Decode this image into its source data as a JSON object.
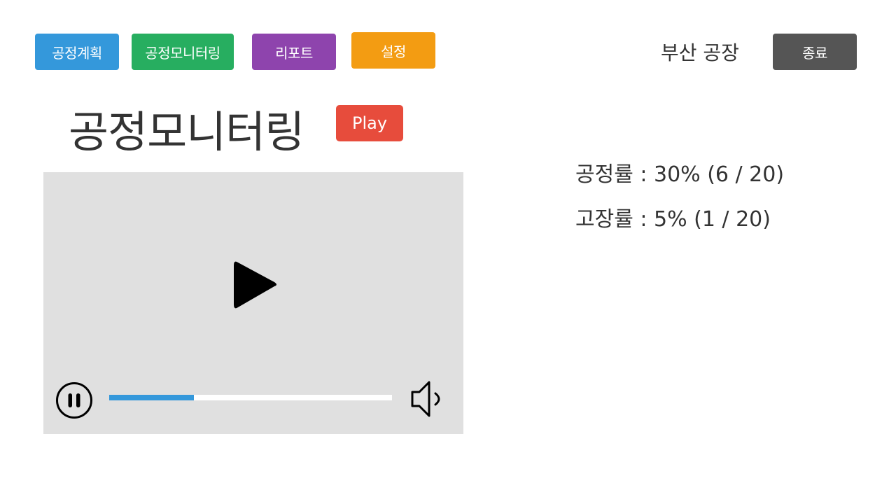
{
  "nav": {
    "plan_label": "공정계획",
    "monitor_label": "공정모니터링",
    "report_label": "리포트",
    "setting_label": "설정"
  },
  "header": {
    "factory_name": "부산 공장",
    "exit_label": "종료"
  },
  "main": {
    "title": "공정모니터링",
    "play_label": "Play"
  },
  "video": {
    "progress_fraction": 0.3
  },
  "stats": {
    "progress_text": "공정률 : 30% (6 / 20)",
    "fault_text": "고장률 : 5% (1 / 20)"
  },
  "colors": {
    "plan": "#3498db",
    "monitor": "#27ae60",
    "report": "#8e44ad",
    "setting": "#f39c12",
    "exit": "#555555",
    "play": "#e74c3c",
    "video_bg": "#e0e0e0",
    "progress": "#3498db"
  },
  "icons": {
    "big_play": "play-icon",
    "pause": "pause-icon",
    "volume": "volume-icon"
  }
}
